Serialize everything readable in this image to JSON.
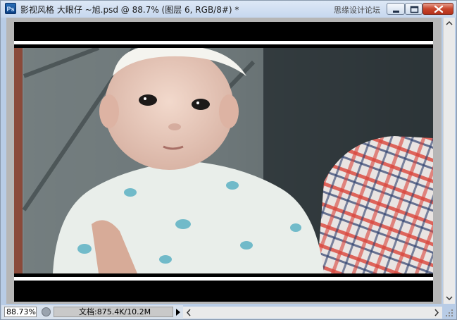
{
  "window": {
    "app_icon_label": "Ps",
    "title": "影视风格 大眼仔 ~旭.psd @ 88.7% (图层 6, RGB/8#) *",
    "watermark": "思缘设计论坛",
    "icons": [
      "photoshop-app-icon",
      "minimize-icon",
      "maximize-icon",
      "close-icon"
    ]
  },
  "canvas": {
    "description_icons": [
      "letterbox-bar",
      "photo"
    ],
    "colors": {
      "letterbox": "#000000",
      "stripe": "#ffffff",
      "pasteboard": "#b6b6b6"
    }
  },
  "status_bar": {
    "zoom": "88.73%",
    "doc_info": "文档:875.4K/10.2M",
    "icons": [
      "status-indicator-icon",
      "status-menu-arrow-icon"
    ]
  },
  "scrollbars": {
    "icons": [
      "scroll-up-icon",
      "scroll-down-icon",
      "scroll-left-icon",
      "scroll-right-icon",
      "resize-grip-icon"
    ]
  }
}
